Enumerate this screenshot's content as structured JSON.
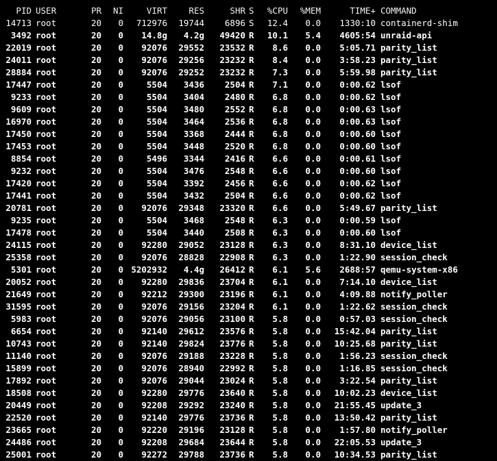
{
  "terminal": {
    "headers": {
      "pid": "PID",
      "user": "USER",
      "pr": "PR",
      "ni": "NI",
      "virt": "VIRT",
      "res": "RES",
      "shr": "SHR",
      "s": "S",
      "cpu": "%CPU",
      "mem": "%MEM",
      "time": "TIME+",
      "command": "COMMAND"
    },
    "processes": [
      {
        "pid": "14713",
        "user": "root",
        "pr": "20",
        "ni": "0",
        "virt": "712976",
        "res": "19744",
        "shr": "6896",
        "s": "S",
        "cpu": "12.4",
        "mem": "0.0",
        "time": "1330:10",
        "command": "containerd-shim"
      },
      {
        "pid": "3492",
        "user": "root",
        "pr": "20",
        "ni": "0",
        "virt": "14.8g",
        "res": "4.2g",
        "shr": "49420",
        "s": "R",
        "cpu": "10.1",
        "mem": "5.4",
        "time": "4605:54",
        "command": "unraid-api"
      },
      {
        "pid": "22019",
        "user": "root",
        "pr": "20",
        "ni": "0",
        "virt": "92076",
        "res": "29552",
        "shr": "23532",
        "s": "R",
        "cpu": "8.6",
        "mem": "0.0",
        "time": "5:05.71",
        "command": "parity_list"
      },
      {
        "pid": "24011",
        "user": "root",
        "pr": "20",
        "ni": "0",
        "virt": "92076",
        "res": "29256",
        "shr": "23232",
        "s": "R",
        "cpu": "8.4",
        "mem": "0.0",
        "time": "3:58.23",
        "command": "parity_list"
      },
      {
        "pid": "28884",
        "user": "root",
        "pr": "20",
        "ni": "0",
        "virt": "92076",
        "res": "29252",
        "shr": "23232",
        "s": "R",
        "cpu": "7.3",
        "mem": "0.0",
        "time": "5:59.98",
        "command": "parity_list"
      },
      {
        "pid": "17447",
        "user": "root",
        "pr": "20",
        "ni": "0",
        "virt": "5504",
        "res": "3436",
        "shr": "2504",
        "s": "R",
        "cpu": "7.1",
        "mem": "0.0",
        "time": "0:00.62",
        "command": "lsof"
      },
      {
        "pid": "9233",
        "user": "root",
        "pr": "20",
        "ni": "0",
        "virt": "5504",
        "res": "3404",
        "shr": "2480",
        "s": "R",
        "cpu": "6.8",
        "mem": "0.0",
        "time": "0:00.62",
        "command": "lsof"
      },
      {
        "pid": "9609",
        "user": "root",
        "pr": "20",
        "ni": "0",
        "virt": "5504",
        "res": "3480",
        "shr": "2552",
        "s": "R",
        "cpu": "6.8",
        "mem": "0.0",
        "time": "0:00.63",
        "command": "lsof"
      },
      {
        "pid": "16970",
        "user": "root",
        "pr": "20",
        "ni": "0",
        "virt": "5504",
        "res": "3464",
        "shr": "2536",
        "s": "R",
        "cpu": "6.8",
        "mem": "0.0",
        "time": "0:00.63",
        "command": "lsof"
      },
      {
        "pid": "17450",
        "user": "root",
        "pr": "20",
        "ni": "0",
        "virt": "5504",
        "res": "3368",
        "shr": "2444",
        "s": "R",
        "cpu": "6.8",
        "mem": "0.0",
        "time": "0:00.60",
        "command": "lsof"
      },
      {
        "pid": "17453",
        "user": "root",
        "pr": "20",
        "ni": "0",
        "virt": "5504",
        "res": "3448",
        "shr": "2520",
        "s": "R",
        "cpu": "6.8",
        "mem": "0.0",
        "time": "0:00.60",
        "command": "lsof"
      },
      {
        "pid": "8854",
        "user": "root",
        "pr": "20",
        "ni": "0",
        "virt": "5496",
        "res": "3344",
        "shr": "2416",
        "s": "R",
        "cpu": "6.6",
        "mem": "0.0",
        "time": "0:00.61",
        "command": "lsof"
      },
      {
        "pid": "9232",
        "user": "root",
        "pr": "20",
        "ni": "0",
        "virt": "5504",
        "res": "3476",
        "shr": "2548",
        "s": "R",
        "cpu": "6.6",
        "mem": "0.0",
        "time": "0:00.60",
        "command": "lsof"
      },
      {
        "pid": "17420",
        "user": "root",
        "pr": "20",
        "ni": "0",
        "virt": "5504",
        "res": "3392",
        "shr": "2456",
        "s": "R",
        "cpu": "6.6",
        "mem": "0.0",
        "time": "0:00.62",
        "command": "lsof"
      },
      {
        "pid": "17441",
        "user": "root",
        "pr": "20",
        "ni": "0",
        "virt": "5504",
        "res": "3432",
        "shr": "2504",
        "s": "R",
        "cpu": "6.6",
        "mem": "0.0",
        "time": "0:00.62",
        "command": "lsof"
      },
      {
        "pid": "20781",
        "user": "root",
        "pr": "20",
        "ni": "0",
        "virt": "92076",
        "res": "29348",
        "shr": "23320",
        "s": "R",
        "cpu": "6.6",
        "mem": "0.0",
        "time": "5:49.67",
        "command": "parity_list"
      },
      {
        "pid": "9235",
        "user": "root",
        "pr": "20",
        "ni": "0",
        "virt": "5504",
        "res": "3468",
        "shr": "2548",
        "s": "R",
        "cpu": "6.3",
        "mem": "0.0",
        "time": "0:00.59",
        "command": "lsof"
      },
      {
        "pid": "17478",
        "user": "root",
        "pr": "20",
        "ni": "0",
        "virt": "5504",
        "res": "3440",
        "shr": "2508",
        "s": "R",
        "cpu": "6.3",
        "mem": "0.0",
        "time": "0:00.60",
        "command": "lsof"
      },
      {
        "pid": "24115",
        "user": "root",
        "pr": "20",
        "ni": "0",
        "virt": "92280",
        "res": "29052",
        "shr": "23128",
        "s": "R",
        "cpu": "6.3",
        "mem": "0.0",
        "time": "8:31.10",
        "command": "device_list"
      },
      {
        "pid": "25358",
        "user": "root",
        "pr": "20",
        "ni": "0",
        "virt": "92076",
        "res": "28828",
        "shr": "22908",
        "s": "R",
        "cpu": "6.3",
        "mem": "0.0",
        "time": "1:22.90",
        "command": "session_check"
      },
      {
        "pid": "5301",
        "user": "root",
        "pr": "20",
        "ni": "0",
        "virt": "5202932",
        "res": "4.4g",
        "shr": "26412",
        "s": "R",
        "cpu": "6.1",
        "mem": "5.6",
        "time": "2688:57",
        "command": "qemu-system-x86"
      },
      {
        "pid": "20052",
        "user": "root",
        "pr": "20",
        "ni": "0",
        "virt": "92280",
        "res": "29836",
        "shr": "23704",
        "s": "R",
        "cpu": "6.1",
        "mem": "0.0",
        "time": "7:14.10",
        "command": "device_list"
      },
      {
        "pid": "21649",
        "user": "root",
        "pr": "20",
        "ni": "0",
        "virt": "92212",
        "res": "29300",
        "shr": "23196",
        "s": "R",
        "cpu": "6.1",
        "mem": "0.0",
        "time": "4:09.88",
        "command": "notify_poller"
      },
      {
        "pid": "31595",
        "user": "root",
        "pr": "20",
        "ni": "0",
        "virt": "92076",
        "res": "29156",
        "shr": "23204",
        "s": "R",
        "cpu": "6.1",
        "mem": "0.0",
        "time": "1:22.62",
        "command": "session_check"
      },
      {
        "pid": "5983",
        "user": "root",
        "pr": "20",
        "ni": "0",
        "virt": "92076",
        "res": "29056",
        "shr": "23100",
        "s": "R",
        "cpu": "5.8",
        "mem": "0.0",
        "time": "0:57.03",
        "command": "session_check"
      },
      {
        "pid": "6654",
        "user": "root",
        "pr": "20",
        "ni": "0",
        "virt": "92140",
        "res": "29612",
        "shr": "23576",
        "s": "R",
        "cpu": "5.8",
        "mem": "0.0",
        "time": "15:42.04",
        "command": "parity_list"
      },
      {
        "pid": "10743",
        "user": "root",
        "pr": "20",
        "ni": "0",
        "virt": "92140",
        "res": "29824",
        "shr": "23776",
        "s": "R",
        "cpu": "5.8",
        "mem": "0.0",
        "time": "10:25.68",
        "command": "parity_list"
      },
      {
        "pid": "11140",
        "user": "root",
        "pr": "20",
        "ni": "0",
        "virt": "92076",
        "res": "29188",
        "shr": "23228",
        "s": "R",
        "cpu": "5.8",
        "mem": "0.0",
        "time": "1:56.23",
        "command": "session_check"
      },
      {
        "pid": "15899",
        "user": "root",
        "pr": "20",
        "ni": "0",
        "virt": "92076",
        "res": "28940",
        "shr": "22992",
        "s": "R",
        "cpu": "5.8",
        "mem": "0.0",
        "time": "1:16.85",
        "command": "session_check"
      },
      {
        "pid": "17892",
        "user": "root",
        "pr": "20",
        "ni": "0",
        "virt": "92076",
        "res": "29044",
        "shr": "23024",
        "s": "R",
        "cpu": "5.8",
        "mem": "0.0",
        "time": "3:22.54",
        "command": "parity_list"
      },
      {
        "pid": "18508",
        "user": "root",
        "pr": "20",
        "ni": "0",
        "virt": "92280",
        "res": "29776",
        "shr": "23640",
        "s": "R",
        "cpu": "5.8",
        "mem": "0.0",
        "time": "10:02.23",
        "command": "device_list"
      },
      {
        "pid": "20449",
        "user": "root",
        "pr": "20",
        "ni": "0",
        "virt": "92208",
        "res": "29292",
        "shr": "23240",
        "s": "R",
        "cpu": "5.8",
        "mem": "0.0",
        "time": "21:55.45",
        "command": "update_3"
      },
      {
        "pid": "22520",
        "user": "root",
        "pr": "20",
        "ni": "0",
        "virt": "92140",
        "res": "29776",
        "shr": "23736",
        "s": "R",
        "cpu": "5.8",
        "mem": "0.0",
        "time": "13:50.42",
        "command": "parity_list"
      },
      {
        "pid": "23665",
        "user": "root",
        "pr": "20",
        "ni": "0",
        "virt": "92220",
        "res": "29196",
        "shr": "23128",
        "s": "R",
        "cpu": "5.8",
        "mem": "0.0",
        "time": "1:57.80",
        "command": "notify_poller"
      },
      {
        "pid": "24486",
        "user": "root",
        "pr": "20",
        "ni": "0",
        "virt": "92208",
        "res": "29684",
        "shr": "23644",
        "s": "R",
        "cpu": "5.8",
        "mem": "0.0",
        "time": "22:05.53",
        "command": "update_3"
      },
      {
        "pid": "25001",
        "user": "root",
        "pr": "20",
        "ni": "0",
        "virt": "92272",
        "res": "29788",
        "shr": "23736",
        "s": "R",
        "cpu": "5.8",
        "mem": "0.0",
        "time": "10:34.53",
        "command": "parity_list"
      }
    ]
  }
}
